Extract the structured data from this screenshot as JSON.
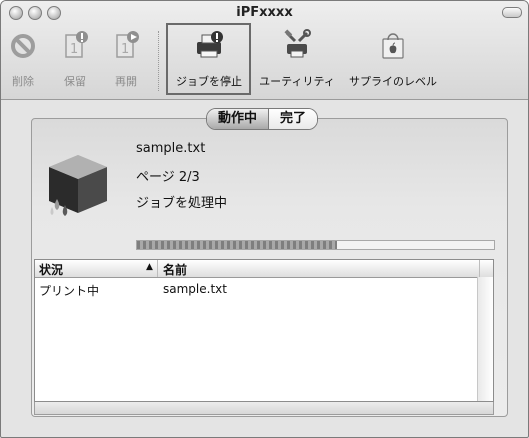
{
  "window": {
    "title": "iPFxxxx"
  },
  "toolbar": {
    "delete_label": "削除",
    "hold_label": "保留",
    "resume_label": "再開",
    "stop_jobs_label": "ジョブを停止",
    "utility_label": "ユーティリティ",
    "supply_levels_label": "サプライのレベル"
  },
  "tabs": [
    {
      "label": "動作中",
      "selected": true
    },
    {
      "label": "完了",
      "selected": false
    }
  ],
  "job": {
    "file_name": "sample.txt",
    "page_info": "ページ 2/3",
    "status": "ジョブを処理中",
    "progress_fraction": 0.56
  },
  "table": {
    "columns": [
      "状況",
      "名前"
    ],
    "sort_indicator": "▲",
    "rows": [
      {
        "status": "プリント中",
        "name": "sample.txt"
      }
    ]
  },
  "colors": {
    "window_bg": "#e4e4e4",
    "progress_fill": "#8c8c8c"
  }
}
